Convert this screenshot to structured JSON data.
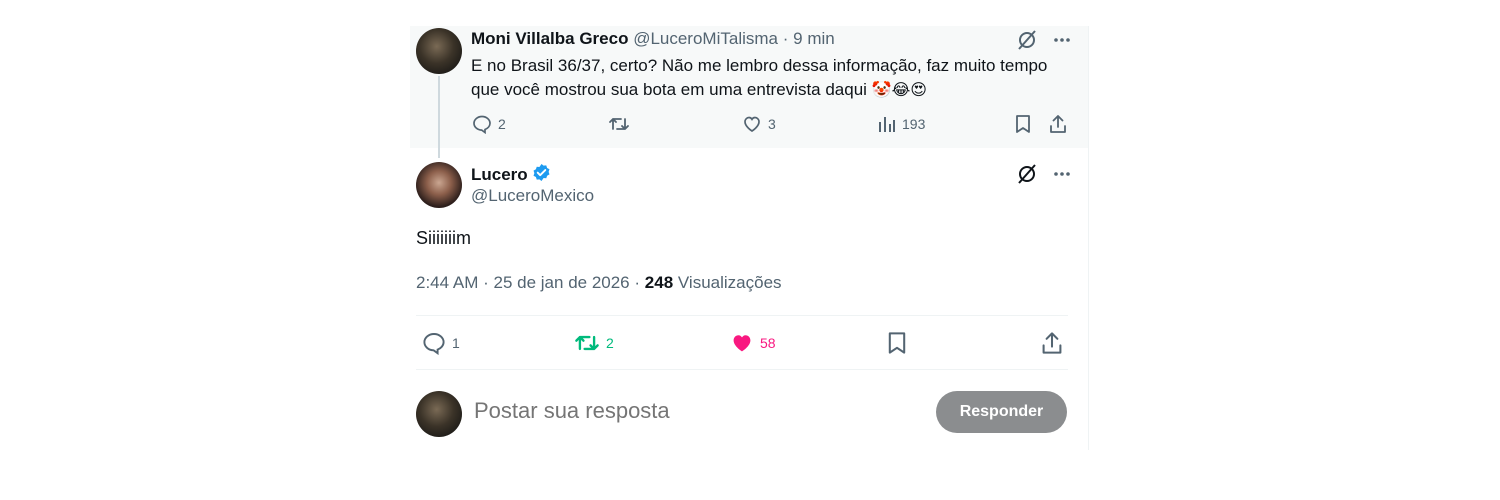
{
  "parent_tweet": {
    "author_name": "Moni Villalba Greco",
    "handle": "@LuceroMiTalisma",
    "separator": "·",
    "time": "9 min",
    "text": "E no Brasil 36/37, certo? Não me lembro dessa informação, faz muito tempo que você mostrou sua bota em uma entrevista daqui",
    "emojis": "🤡😂😍",
    "stats": {
      "replies": "2",
      "likes": "3",
      "views": "193"
    },
    "icons": [
      "grok-icon",
      "more-icon",
      "reply-icon",
      "retweet-icon",
      "like-icon",
      "views-icon",
      "bookmark-icon",
      "share-icon"
    ]
  },
  "main_tweet": {
    "author_name": "Lucero",
    "handle": "@LuceroMexico",
    "text": "Siiiiiiim",
    "time": "2:44 AM",
    "separator": "·",
    "date": "25 de jan de 2026",
    "separator2": "·",
    "views_count": "248",
    "views_label": "Visualizações",
    "stats": {
      "replies": "1",
      "retweets": "2",
      "likes": "58"
    },
    "colors": {
      "retweet_active": "#00ba7c",
      "like_active": "#f91880",
      "verified": "#1d9bf0"
    }
  },
  "composer": {
    "placeholder": "Postar sua resposta",
    "reply_button": "Responder"
  }
}
